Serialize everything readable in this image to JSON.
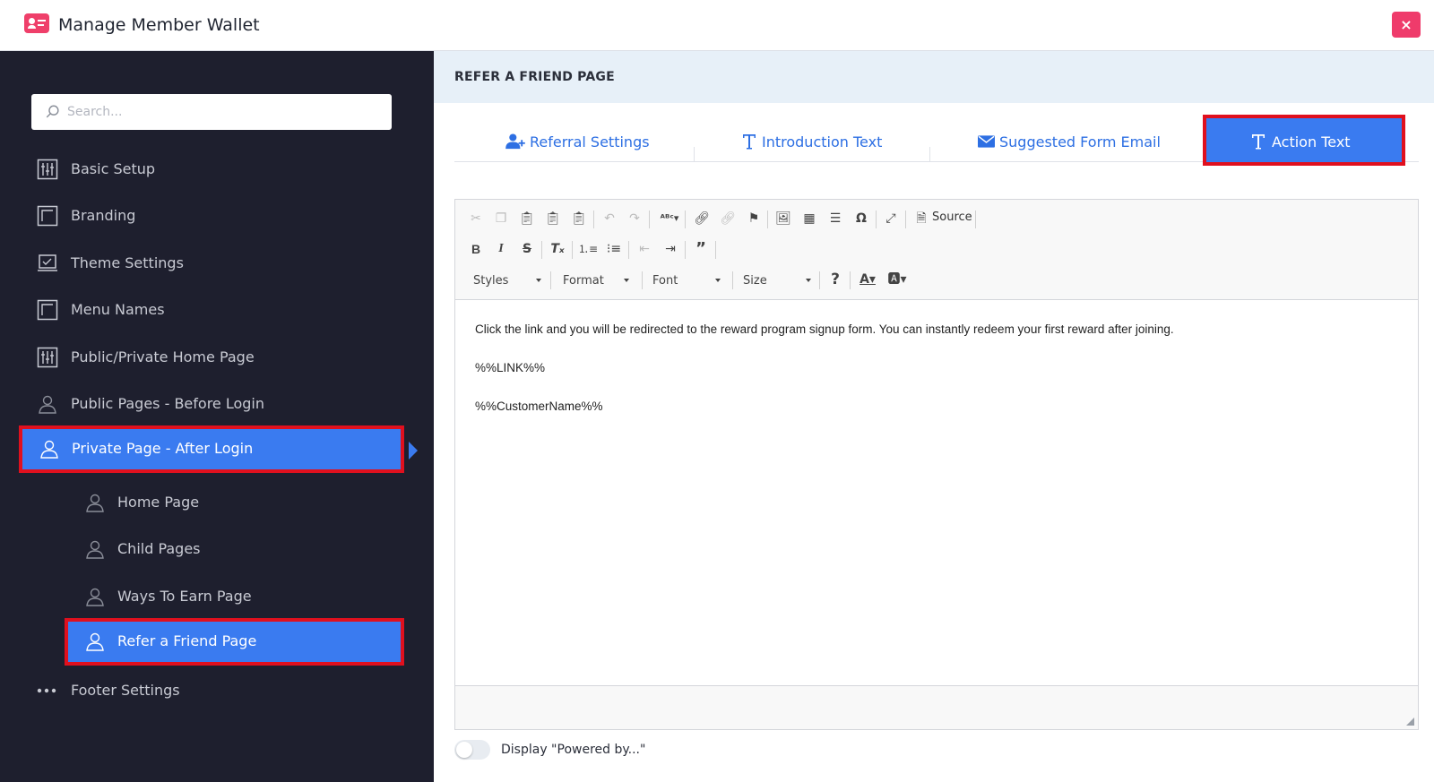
{
  "window": {
    "title": "Manage Member Wallet",
    "close_label": "×"
  },
  "colors": {
    "accent": "#3a7bf0",
    "sidebar_bg": "#1e1f2e",
    "highlight": "#e0101e",
    "brand": "#ef3f6a"
  },
  "sidebar": {
    "search_placeholder": "Search...",
    "items": [
      {
        "label": "Basic Setup",
        "icon": "sliders-icon"
      },
      {
        "label": "Branding",
        "icon": "frame-icon"
      },
      {
        "label": "Theme Settings",
        "icon": "laptop-icon"
      },
      {
        "label": "Menu Names",
        "icon": "frame-icon"
      },
      {
        "label": "Public/Private Home Page",
        "icon": "sliders-icon"
      },
      {
        "label": "Public Pages - Before Login",
        "icon": "user-icon"
      },
      {
        "label": "Private Page - After Login",
        "icon": "user-icon",
        "active": true
      },
      {
        "label": "Home Page",
        "icon": "user-icon"
      },
      {
        "label": "Child Pages",
        "icon": "user-icon"
      },
      {
        "label": "Ways To Earn Page",
        "icon": "user-icon"
      },
      {
        "label": "Refer a Friend Page",
        "icon": "user-icon",
        "active": true
      },
      {
        "label": "Footer Settings",
        "icon": "ellipsis-icon"
      }
    ]
  },
  "main": {
    "header": "REFER A FRIEND PAGE",
    "tabs": [
      {
        "label": "Referral Settings",
        "icon": "user-plus-icon"
      },
      {
        "label": "Introduction Text",
        "icon": "text-icon"
      },
      {
        "label": "Suggested Form Email",
        "icon": "envelope-icon"
      },
      {
        "label": "Action Text",
        "icon": "text-icon",
        "active": true
      }
    ],
    "editor": {
      "toolbar": {
        "source_label": "Source",
        "styles_label": "Styles",
        "format_label": "Format",
        "font_label": "Font",
        "size_label": "Size"
      },
      "content": [
        "Click the link and you will be redirected to the reward program signup form. You can instantly redeem your first reward after joining.",
        "%%LINK%%",
        "%%CustomerName%%"
      ]
    },
    "powered_by_label": "Display \"Powered by...\""
  }
}
